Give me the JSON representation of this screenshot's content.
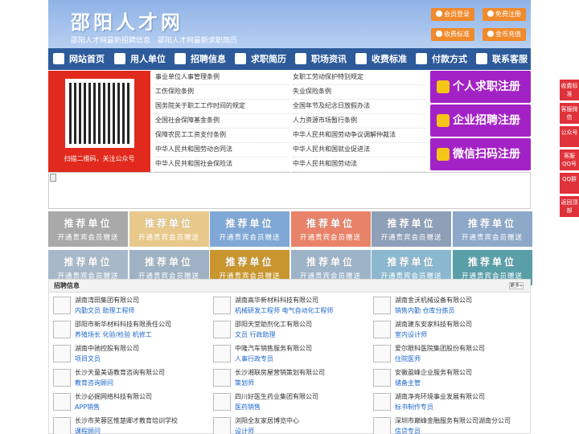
{
  "site": {
    "title": "邵阳人才网",
    "subtitle": "邵阳人才网最新招聘信息   邵阳人才网最新求职简历"
  },
  "header_buttons": [
    "会员登录",
    "免费注册",
    "收费标准",
    "金币充值"
  ],
  "nav": [
    "网站首页",
    "用人单位",
    "招聘信息",
    "求职简历",
    "职场资讯",
    "收费标准",
    "付款方式",
    "联系客服"
  ],
  "qr": {
    "caption": "扫描二维码，关注公众号"
  },
  "links": [
    [
      "事业单位人事管理条例",
      "女职工劳动保护特别规定"
    ],
    [
      "工伤保险条例",
      "失业保险条例"
    ],
    [
      "国务院关于职工工作时间的规定",
      "全国年节及纪念日放假办法"
    ],
    [
      "全国社会保障基金条例",
      "人力资源市场暂行条例"
    ],
    [
      "保障农民工工资支付条例",
      "中华人民共和国劳动争议调解仲裁法"
    ],
    [
      "中华人民共和国劳动合同法",
      "中华人民共和国就业促进法"
    ],
    [
      "中华人民共和国社会保险法",
      "中华人民共和国劳动法"
    ]
  ],
  "register": [
    "个人求职注册",
    "企业招聘注册",
    "微信扫码注册"
  ],
  "tiles": {
    "title": "推荐单位",
    "sub": "开通贵宾会员赠送",
    "colors": [
      "#a9a9a9",
      "#e8c98b",
      "#7fa8d6",
      "#e8836a",
      "#8e9fb8",
      "#8ea8c9",
      "#a7b9c9",
      "#9fb2c3",
      "#c8952e",
      "#9db3c8",
      "#8bb8cf",
      "#5a9fa8"
    ]
  },
  "jobs": {
    "header": "招聘信息",
    "more": "更多»",
    "items": [
      {
        "company": "湖南湾田集团有限公司",
        "positions": "内勤文员 助理工程师"
      },
      {
        "company": "湖南高华新材料科技有限公司",
        "positions": "机械研发工程师 电气自动化工程师"
      },
      {
        "company": "湖南金沃机械设备有限公司",
        "positions": "销售内勤 仓库分拣员"
      },
      {
        "company": "邵阳市新华材料科技有限责任公司",
        "positions": "养殖场长 化验/检验 机修工"
      },
      {
        "company": "邵阳天堂助剂化工有限公司",
        "positions": "文员 行政助理"
      },
      {
        "company": "湖南建东安家科技有限公司",
        "positions": "室内设计师"
      },
      {
        "company": "湖南中驰控股有限公司",
        "positions": "项目文员"
      },
      {
        "company": "中隆汽车销售服务有限公司",
        "positions": "人事行政专员"
      },
      {
        "company": "爱尔眼科医院集团股份有限公司",
        "positions": "住院医师"
      },
      {
        "company": "长沙天童美语教育咨询有限公司",
        "positions": "教育咨询顾问"
      },
      {
        "company": "长沙湘联房屋营销策划有限公司",
        "positions": "策划师"
      },
      {
        "company": "安徽盈峰企业服务有限公司",
        "positions": "储备主管"
      },
      {
        "company": "长沙必掘网络科技有限公司",
        "positions": "APP销售"
      },
      {
        "company": "四川好医生药业集团有限公司",
        "positions": "医药销售"
      },
      {
        "company": "湖南净亮环境事业发展有限公司",
        "positions": "标书制作专员"
      },
      {
        "company": "长沙市芙蓉区惟楚卿才教育培训学校",
        "positions": "课程顾问"
      },
      {
        "company": "浏阳全友家居博览中心",
        "positions": "设计师"
      },
      {
        "company": "深圳市巅峰金融服务有限公司湖南分公司",
        "positions": "信贷专员"
      }
    ]
  },
  "side": [
    "收费标准",
    "客服微信",
    "公众号",
    "客服QQ号",
    "QQ群",
    "返回顶部"
  ]
}
